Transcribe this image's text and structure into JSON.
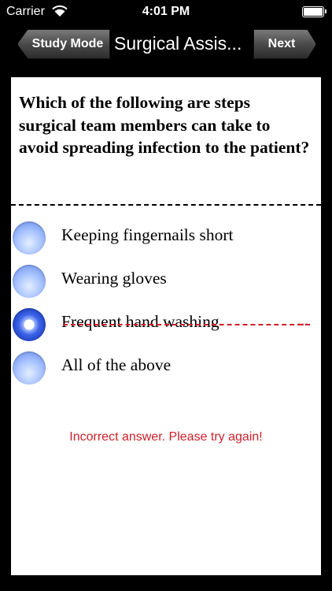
{
  "status_bar": {
    "carrier": "Carrier",
    "time": "4:01 PM"
  },
  "nav": {
    "back_label": "Study Mode",
    "title": "Surgical Assis...",
    "next_label": "Next"
  },
  "question": "Which of the following are steps surgical team members can take to avoid spreading infection to the patient?",
  "options": [
    {
      "label": "Keeping fingernails short",
      "selected": false,
      "crossed_out": false
    },
    {
      "label": "Wearing gloves",
      "selected": false,
      "crossed_out": false
    },
    {
      "label": "Frequent hand washing",
      "selected": true,
      "crossed_out": true
    },
    {
      "label": "All of the above",
      "selected": false,
      "crossed_out": false
    }
  ],
  "feedback": "Incorrect answer. Please try again!",
  "colors": {
    "error": "#d0202a",
    "radio": "#a9c4ff",
    "background": "#000000"
  }
}
